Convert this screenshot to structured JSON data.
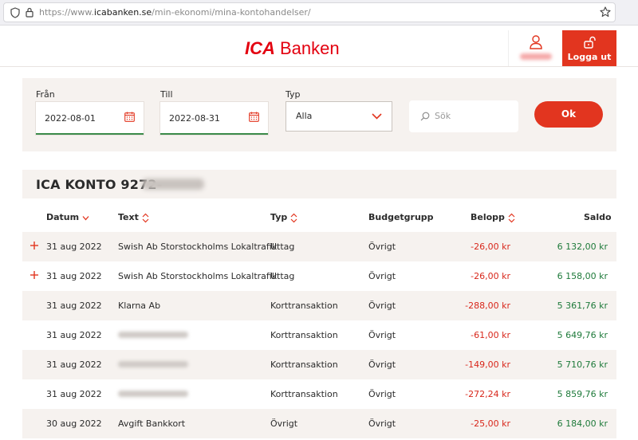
{
  "browser": {
    "url_prefix": "https://www.",
    "url_domain": "icabanken.se",
    "url_path": "/min-ekonomi/mina-kontohandelser/"
  },
  "header": {
    "logo_ica": "ICA",
    "logo_rest": " Banken",
    "logout_label": "Logga ut"
  },
  "filters": {
    "from_label": "Från",
    "from_value": "2022-08-01",
    "to_label": "Till",
    "to_value": "2022-08-31",
    "type_label": "Typ",
    "type_value": "Alla",
    "search_placeholder": "Sök",
    "ok_label": "Ok"
  },
  "account": {
    "title": "ICA KONTO 9272-"
  },
  "table": {
    "columns": {
      "date": "Datum",
      "text": "Text",
      "type": "Typ",
      "budget": "Budgetgrupp",
      "amount": "Belopp",
      "balance": "Saldo"
    },
    "rows": [
      {
        "date": "31 aug 2022",
        "text": "Swish Ab Storstockholms Lokaltrafik",
        "type": "Uttag",
        "budget": "Övrigt",
        "amount": "-26,00 kr",
        "balance": "6 132,00 kr"
      },
      {
        "date": "31 aug 2022",
        "text": "Swish Ab Storstockholms Lokaltrafik",
        "type": "Uttag",
        "budget": "Övrigt",
        "amount": "-26,00 kr",
        "balance": "6 158,00 kr"
      },
      {
        "date": "31 aug 2022",
        "text": "Klarna Ab",
        "type": "Korttransaktion",
        "budget": "Övrigt",
        "amount": "-288,00 kr",
        "balance": "5 361,76 kr"
      },
      {
        "date": "31 aug 2022",
        "text": "",
        "type": "Korttransaktion",
        "budget": "Övrigt",
        "amount": "-61,00 kr",
        "balance": "5 649,76 kr"
      },
      {
        "date": "31 aug 2022",
        "text": "",
        "type": "Korttransaktion",
        "budget": "Övrigt",
        "amount": "-149,00 kr",
        "balance": "5 710,76 kr"
      },
      {
        "date": "31 aug 2022",
        "text": "",
        "type": "Korttransaktion",
        "budget": "Övrigt",
        "amount": "-272,24 kr",
        "balance": "5 859,76 kr"
      },
      {
        "date": "30 aug 2022",
        "text": "Avgift Bankkort",
        "type": "Övrigt",
        "budget": "Övrigt",
        "amount": "-25,00 kr",
        "balance": "6 184,00 kr"
      }
    ]
  },
  "colors": {
    "brand_red": "#e3000f",
    "button_red": "#e2351f",
    "amount_red": "#d8271b",
    "balance_green": "#1e7a3a",
    "panel_beige": "#f6f2ef"
  }
}
